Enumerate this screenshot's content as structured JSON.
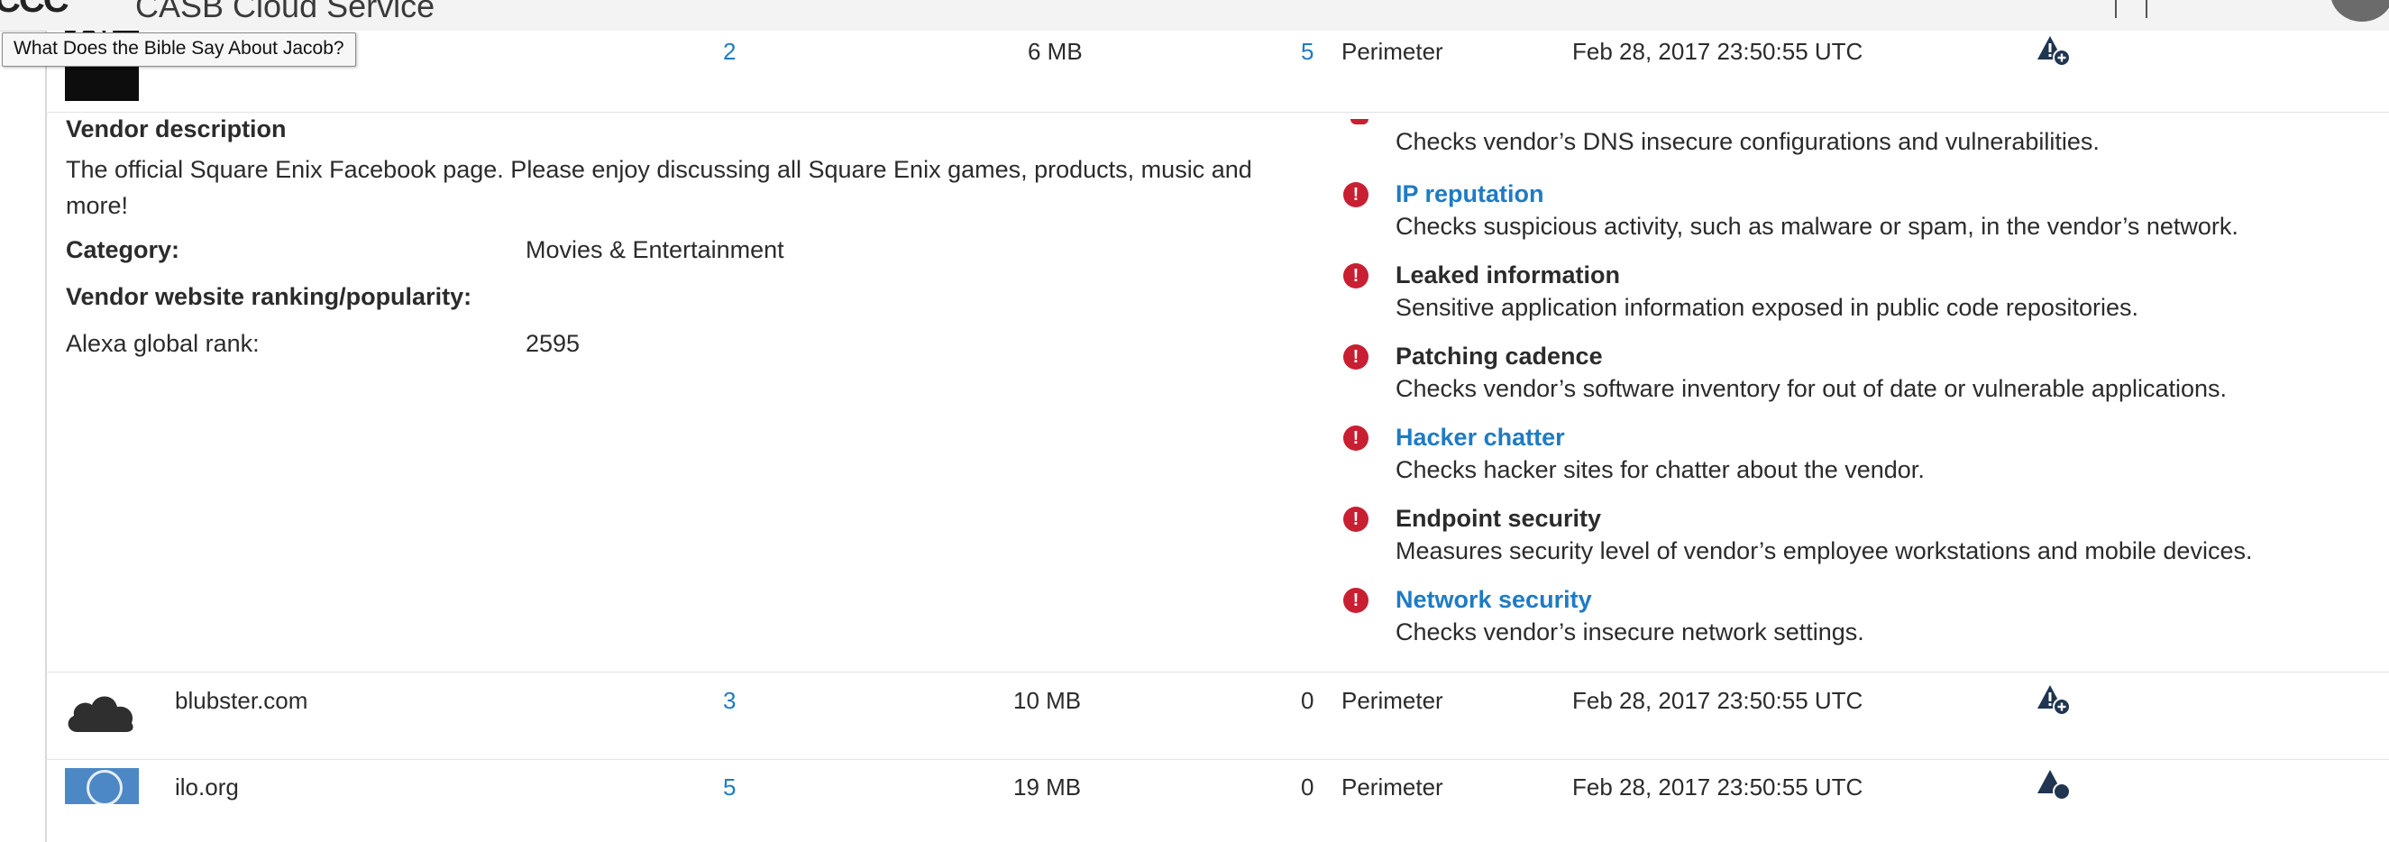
{
  "app": {
    "title": "CASB Cloud Service",
    "logo_text": "CCC"
  },
  "tooltip": {
    "text": "What Does the Bible Say About Jacob?"
  },
  "rows": [
    {
      "vendor_name": "",
      "logo": "square-enix-logo",
      "users": "2",
      "data": "6 MB",
      "risk_count": "5",
      "source": "Perimeter",
      "last_seen": "Feb 28, 2017 23:50:55 UTC",
      "action_icon": "alert-add-icon"
    },
    {
      "vendor_name": "blubster.com",
      "logo": "cloud-icon",
      "users": "3",
      "data": "10 MB",
      "risk_count": "0",
      "source": "Perimeter",
      "last_seen": "Feb 28, 2017 23:50:55 UTC",
      "action_icon": "alert-add-icon"
    },
    {
      "vendor_name": "ilo.org",
      "logo": "ilo-logo",
      "users": "5",
      "data": "19 MB",
      "risk_count": "0",
      "source": "Perimeter",
      "last_seen": "Feb 28, 2017 23:50:55 UTC",
      "action_icon": "alert-add-icon"
    }
  ],
  "details": {
    "description_label": "Vendor description",
    "description_text": "The official Square Enix Facebook page. Please enjoy discussing all Square Enix games, products, music and more!",
    "category_label": "Category:",
    "category_value": "Movies & Entertainment",
    "ranking_label": "Vendor website ranking/popularity:",
    "alexa_label": "Alexa global rank:",
    "alexa_value": "2595"
  },
  "risks": {
    "clipped_desc": "Checks vendor’s DNS insecure configurations and vulnerabilities.",
    "items": [
      {
        "title": "IP reputation",
        "is_link": true,
        "desc": "Checks suspicious activity, such as malware or spam, in the vendor’s network."
      },
      {
        "title": "Leaked information",
        "is_link": false,
        "desc": "Sensitive application information exposed in public code repositories."
      },
      {
        "title": "Patching cadence",
        "is_link": false,
        "desc": "Checks vendor’s software inventory for out of date or vulnerable applications."
      },
      {
        "title": "Hacker chatter",
        "is_link": true,
        "desc": "Checks hacker sites for chatter about the vendor."
      },
      {
        "title": "Endpoint security",
        "is_link": false,
        "desc": "Measures security level of vendor’s employee workstations and mobile devices."
      },
      {
        "title": "Network security",
        "is_link": true,
        "desc": "Checks vendor’s insecure network settings."
      }
    ]
  },
  "colors": {
    "link": "#1e7bc4",
    "danger": "#c81f32",
    "text": "#2b2b2b"
  }
}
